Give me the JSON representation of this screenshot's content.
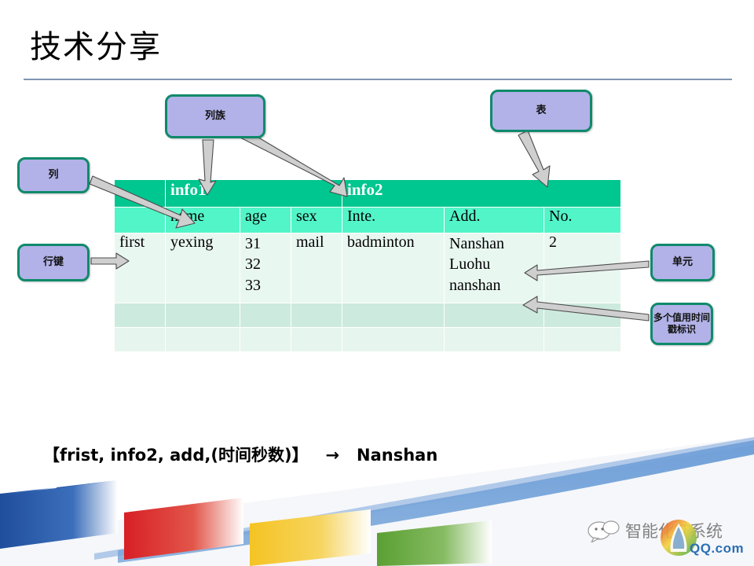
{
  "slide": {
    "title": "技术分享"
  },
  "callouts": {
    "column_family": "列族",
    "table": "表",
    "column": "列",
    "row_key": "行键",
    "cell": "单元",
    "timestamp": "多个值用时间戳标识"
  },
  "table": {
    "column_family_row": {
      "rowkey_blank": "",
      "info1": "info1",
      "info2": "info2"
    },
    "column_row": {
      "rowkey_blank": "",
      "name": "name",
      "age": "age",
      "sex": "sex",
      "inte": "Inte.",
      "add": "Add.",
      "no": "No."
    },
    "data_row": {
      "rowkey": "first",
      "name": "yexing",
      "age": "31\n32\n33",
      "sex": "mail",
      "inte": "badminton",
      "add": "Nanshan\nLuohu\nnanshan",
      "no": "2"
    },
    "empty_rows": 2
  },
  "formula": "【frist, info2, add,(时间秒数)】   →   Nanshan",
  "watermark": {
    "text": "智能化IT系统",
    "logo_text": "QQ.com"
  },
  "colors": {
    "callout_fill": "#b2b2e8",
    "callout_border": "#0f8a6b",
    "header_cf": "#00c68f",
    "header_col": "#52f5c8",
    "data_row": "#e9f7f1",
    "empty_row_a": "#cdeade",
    "empty_row_b": "#e6f5ee",
    "title_rule": "#8096b4",
    "swoosh": "#6f9fd8",
    "bar_blue": "#1f4e9c",
    "bar_red": "#d81f26",
    "bar_yellow": "#f5c323",
    "bar_green": "#5aa033"
  }
}
